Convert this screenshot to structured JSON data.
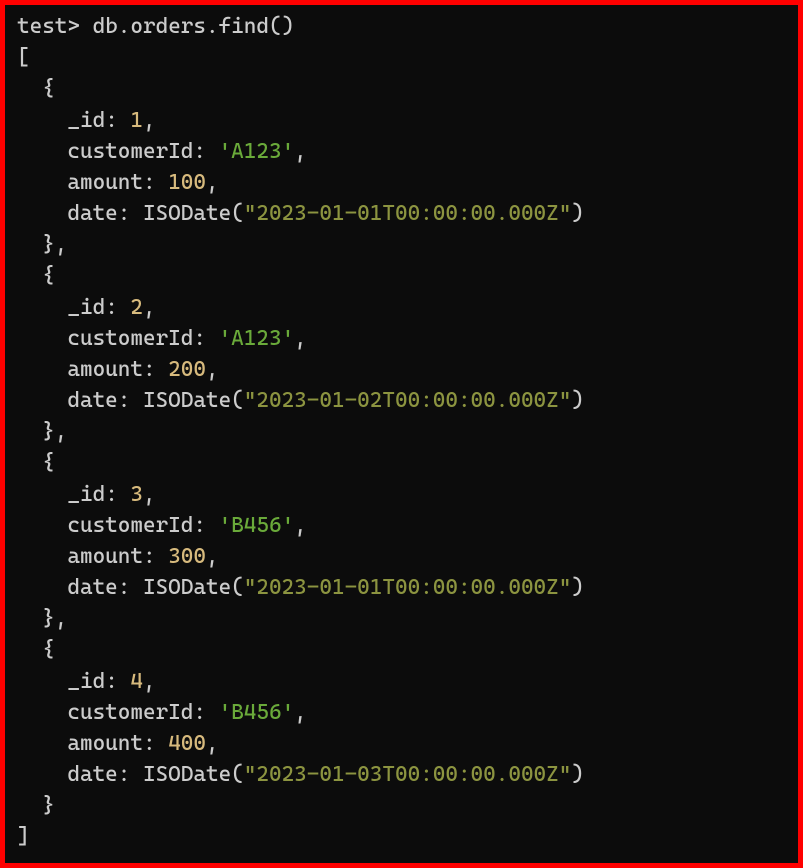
{
  "prompt": {
    "prefix": "test>",
    "command": "db.orders.find()"
  },
  "tokens": {
    "open_bracket": "[",
    "close_bracket": "]",
    "open_brace": "{",
    "close_brace": "}",
    "close_brace_comma": "},",
    "comma": ",",
    "iso_fn": "ISODate",
    "lparen": "(",
    "rparen": ")",
    "dquote": "\""
  },
  "fields": {
    "id": "_id",
    "cust": "customerId",
    "amount": "amount",
    "date": "date"
  },
  "records": [
    {
      "id": "1",
      "cust": "'A123'",
      "amount": "100",
      "date": "2023-01-01T00:00:00.000Z"
    },
    {
      "id": "2",
      "cust": "'A123'",
      "amount": "200",
      "date": "2023-01-02T00:00:00.000Z"
    },
    {
      "id": "3",
      "cust": "'B456'",
      "amount": "300",
      "date": "2023-01-01T00:00:00.000Z"
    },
    {
      "id": "4",
      "cust": "'B456'",
      "amount": "400",
      "date": "2023-01-03T00:00:00.000Z"
    }
  ]
}
